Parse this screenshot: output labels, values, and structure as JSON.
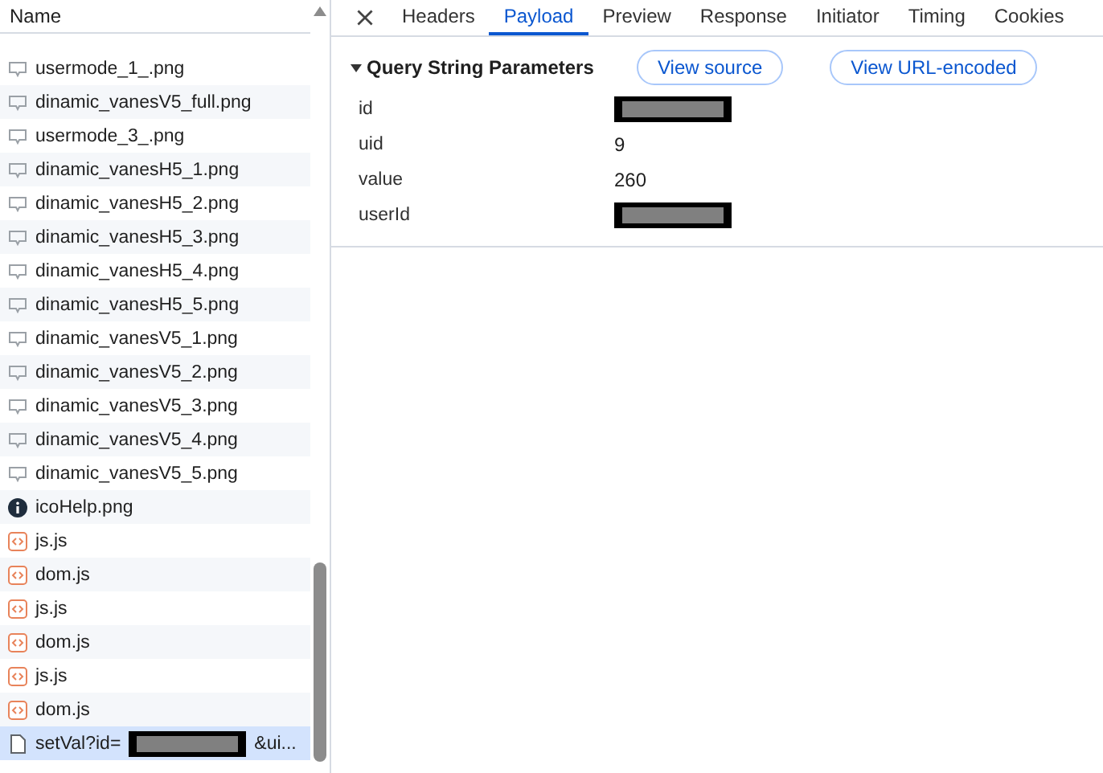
{
  "request_list": {
    "header": "Name",
    "rows": [
      {
        "name": "usermode_1_.png",
        "kind": "image",
        "selected": false
      },
      {
        "name": "dinamic_vanesV5_full.png",
        "kind": "image",
        "selected": false
      },
      {
        "name": "usermode_3_.png",
        "kind": "image",
        "selected": false
      },
      {
        "name": "dinamic_vanesH5_1.png",
        "kind": "image",
        "selected": false
      },
      {
        "name": "dinamic_vanesH5_2.png",
        "kind": "image",
        "selected": false
      },
      {
        "name": "dinamic_vanesH5_3.png",
        "kind": "image",
        "selected": false
      },
      {
        "name": "dinamic_vanesH5_4.png",
        "kind": "image",
        "selected": false
      },
      {
        "name": "dinamic_vanesH5_5.png",
        "kind": "image",
        "selected": false
      },
      {
        "name": "dinamic_vanesV5_1.png",
        "kind": "image",
        "selected": false
      },
      {
        "name": "dinamic_vanesV5_2.png",
        "kind": "image",
        "selected": false
      },
      {
        "name": "dinamic_vanesV5_3.png",
        "kind": "image",
        "selected": false
      },
      {
        "name": "dinamic_vanesV5_4.png",
        "kind": "image",
        "selected": false
      },
      {
        "name": "dinamic_vanesV5_5.png",
        "kind": "image",
        "selected": false
      },
      {
        "name": "icoHelp.png",
        "kind": "info",
        "selected": false
      },
      {
        "name": "js.js",
        "kind": "script",
        "selected": false
      },
      {
        "name": "dom.js",
        "kind": "script",
        "selected": false
      },
      {
        "name": "js.js",
        "kind": "script",
        "selected": false
      },
      {
        "name": "dom.js",
        "kind": "script",
        "selected": false
      },
      {
        "name": "js.js",
        "kind": "script",
        "selected": false
      },
      {
        "name": "dom.js",
        "kind": "script",
        "selected": false
      },
      {
        "name": "setVal?id=",
        "name_end": "&ui...",
        "kind": "document",
        "selected": true
      }
    ]
  },
  "tabs": [
    {
      "label": "Headers",
      "selected": false
    },
    {
      "label": "Payload",
      "selected": true
    },
    {
      "label": "Preview",
      "selected": false
    },
    {
      "label": "Response",
      "selected": false
    },
    {
      "label": "Initiator",
      "selected": false
    },
    {
      "label": "Timing",
      "selected": false
    },
    {
      "label": "Cookies",
      "selected": false
    }
  ],
  "payload": {
    "section_title": "Query String Parameters",
    "expanded": true,
    "buttons": [
      "View source",
      "View URL-encoded"
    ],
    "params": [
      {
        "key": "id",
        "redacted": true
      },
      {
        "key": "uid",
        "value": "9",
        "redacted": false
      },
      {
        "key": "value",
        "value": "260",
        "redacted": false
      },
      {
        "key": "userId",
        "redacted": true
      }
    ]
  }
}
